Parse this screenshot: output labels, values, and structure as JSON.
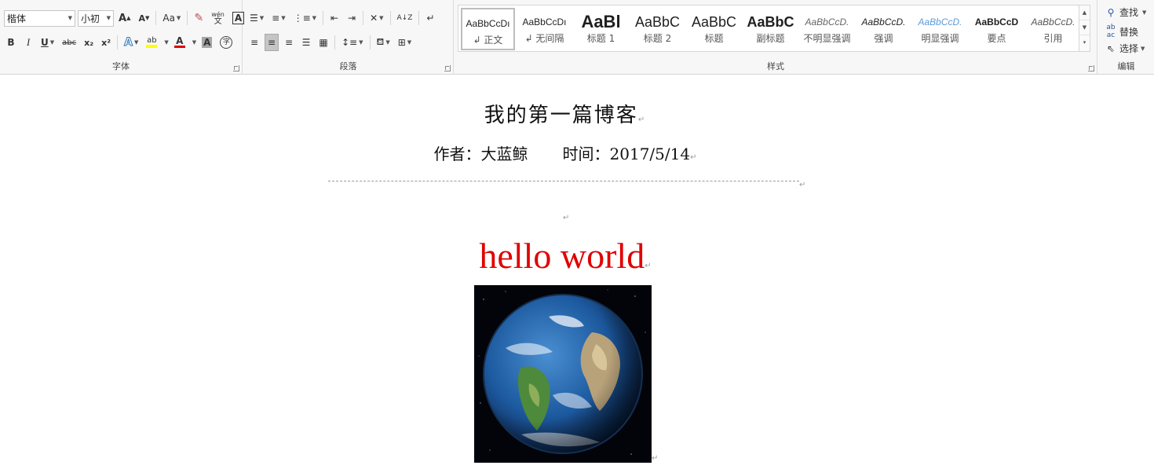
{
  "ribbon": {
    "font": {
      "label": "字体",
      "font_name": "楷体",
      "font_size": "小初",
      "grow_label": "A",
      "shrink_label": "A",
      "change_case_label": "Aa",
      "phonetic_top": "wén",
      "phonetic_bottom": "文",
      "char_border_label": "A",
      "bold_label": "B",
      "italic_label": "I",
      "underline_label": "U",
      "strike_label": "abc",
      "subscript_label": "x₂",
      "superscript_label": "x²",
      "text_effect_label": "A",
      "highlight_label": "ab",
      "font_color_label": "A",
      "char_shading_label": "A",
      "enclose_label": "字",
      "highlight_color": "#ffff00",
      "font_color": "#e00000"
    },
    "paragraph": {
      "label": "段落",
      "sort_label": "A↓Z"
    },
    "styles": {
      "label": "样式",
      "items": [
        {
          "sample": "AaBbCcDı",
          "name": "↲ 正文"
        },
        {
          "sample": "AaBbCcDı",
          "name": "↲ 无间隔"
        },
        {
          "sample": "AaBl",
          "name": "标题 1"
        },
        {
          "sample": "AaBbC",
          "name": "标题 2"
        },
        {
          "sample": "AaBbC",
          "name": "标题"
        },
        {
          "sample": "AaBbC",
          "name": "副标题"
        },
        {
          "sample": "AaBbCcD.",
          "name": "不明显强调"
        },
        {
          "sample": "AaBbCcD.",
          "name": "强调"
        },
        {
          "sample": "AaBbCcD.",
          "name": "明显强调"
        },
        {
          "sample": "AaBbCcD",
          "name": "要点"
        },
        {
          "sample": "AaBbCcD.",
          "name": "引用"
        }
      ],
      "subtle_color": "#5b9bd5"
    },
    "editing": {
      "label": "编辑",
      "find_label": "查找",
      "replace_label": "替换",
      "select_label": "选择"
    }
  },
  "document": {
    "title": "我的第一篇博客",
    "author_text": "作者：大蓝鲸",
    "time_text": "时间：2017/5/14",
    "hello_text": "hello world",
    "hello_color": "#e00000",
    "paragraph_mark": "↵",
    "image_semantic": "earth-image"
  }
}
